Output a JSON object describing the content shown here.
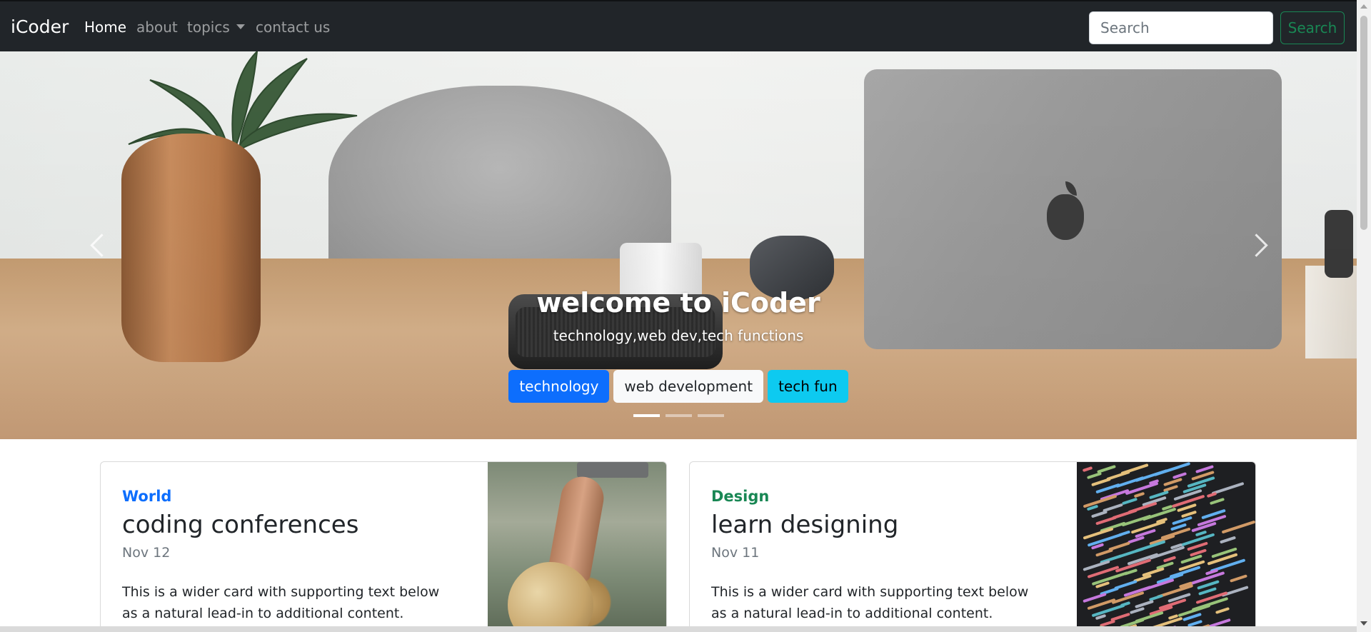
{
  "navbar": {
    "brand": "iCoder",
    "links": [
      {
        "label": "Home",
        "active": true
      },
      {
        "label": "about",
        "active": false
      },
      {
        "label": "topics",
        "active": false,
        "dropdown": true
      },
      {
        "label": "contact us",
        "active": false
      }
    ],
    "search": {
      "placeholder": "Search",
      "value": "",
      "button_label": "Search"
    }
  },
  "hero": {
    "title": "welcome to iCoder",
    "subtitle": "technology,web dev,tech functions",
    "buttons": [
      {
        "label": "technology",
        "style": "primary"
      },
      {
        "label": "web development",
        "style": "light"
      },
      {
        "label": "tech fun",
        "style": "info"
      }
    ],
    "slide_count": 3,
    "active_slide": 1
  },
  "cards": [
    {
      "category": "World",
      "title": "coding conferences",
      "date": "Nov 12",
      "text": "This is a wider card with supporting text below as a natural lead-in to additional content."
    },
    {
      "category": "Design",
      "title": "learn designing",
      "date": "Nov 11",
      "text": "This is a wider card with supporting text below as a natural lead-in to additional content."
    }
  ],
  "colors": {
    "navbar_bg": "#212529",
    "primary": "#0d6efd",
    "success": "#198754",
    "info": "#0dcaf0"
  },
  "icons": [
    "chevron-left-icon",
    "chevron-right-icon",
    "caret-down-icon"
  ]
}
